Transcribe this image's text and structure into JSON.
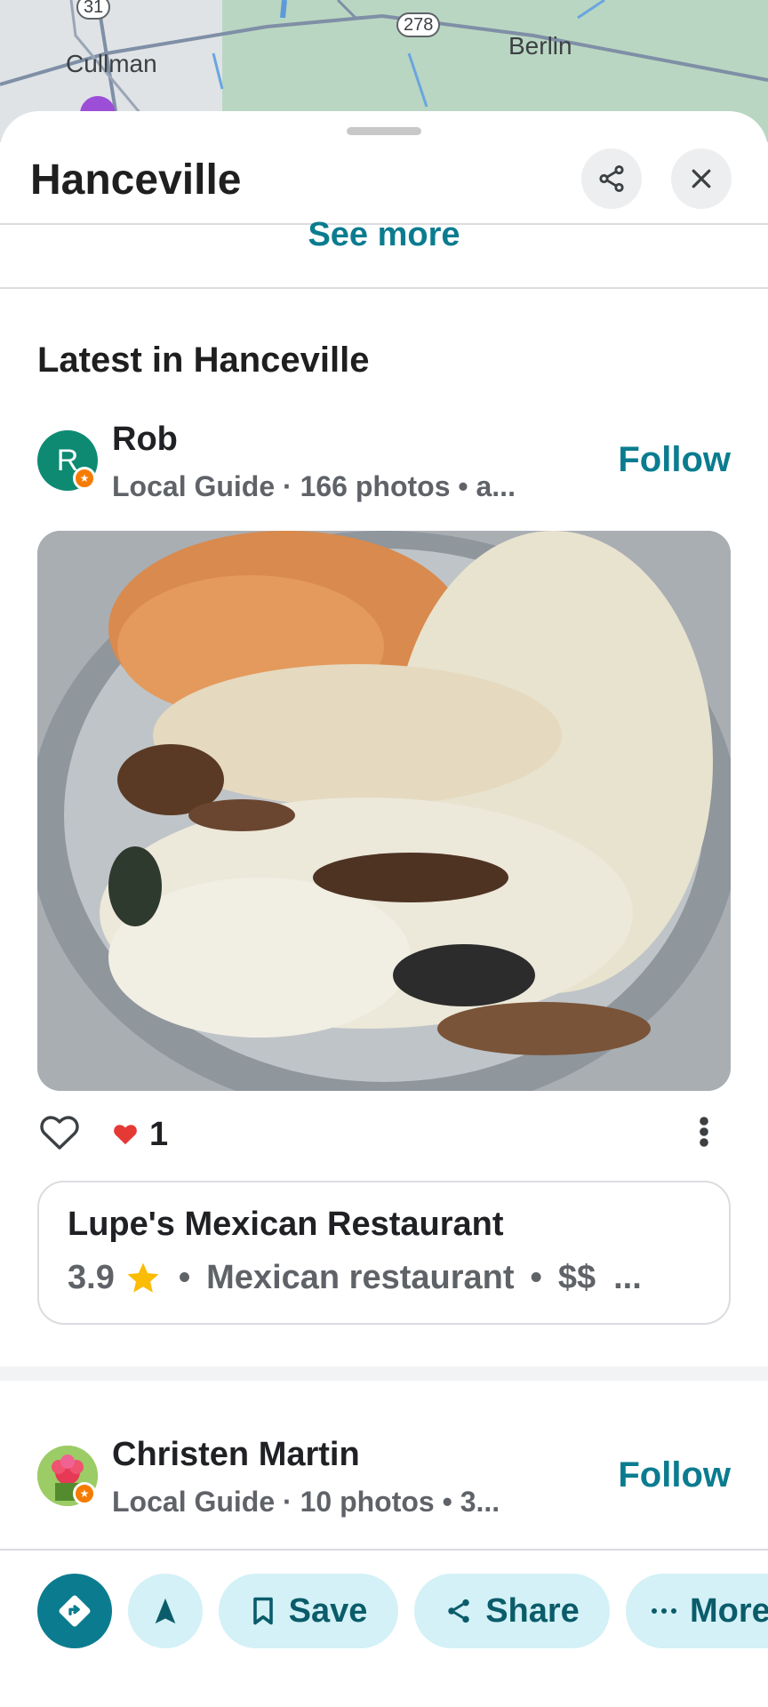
{
  "map": {
    "labels": [
      "Cullman",
      "Berlin"
    ],
    "shields": [
      "31",
      "278"
    ]
  },
  "sheet": {
    "title": "Hanceville",
    "share_icon": "share-icon",
    "close_icon": "close-icon",
    "see_more": "See more",
    "section_title": "Latest in Hanceville"
  },
  "post1": {
    "avatar_letter": "R",
    "avatar_color": "#0e8a73",
    "author": "Rob",
    "meta": "Local Guide · 166 photos  •  a...",
    "follow": "Follow",
    "like_count": "1",
    "place": {
      "name": "Lupe's Mexican Restaurant",
      "rating": "3.9",
      "category": "Mexican restaurant",
      "price": "$$",
      "overflow": "..."
    }
  },
  "post2": {
    "author": "Christen Martin",
    "meta": "Local Guide · 10 photos  •  3...",
    "follow": "Follow"
  },
  "bottom_bar": {
    "save": "Save",
    "share": "Share",
    "more": "More"
  },
  "colors": {
    "accent": "#0b7c8f",
    "pill_bg": "#d3f1f7",
    "heart": "#e53935",
    "star": "#fbbc04"
  }
}
